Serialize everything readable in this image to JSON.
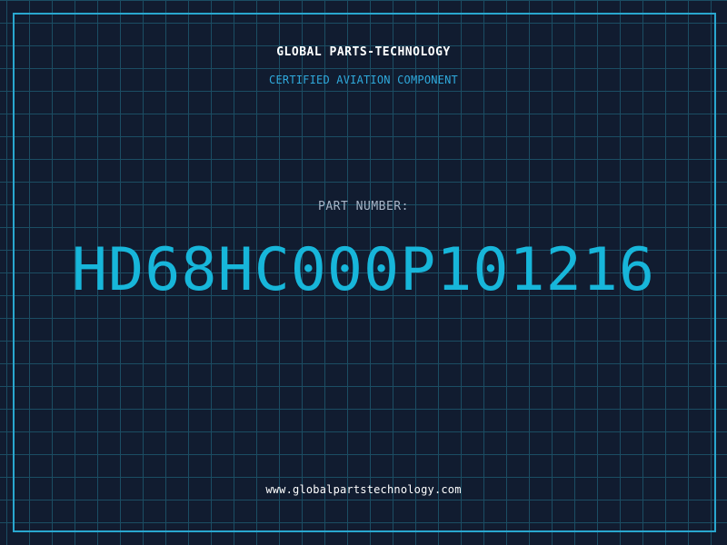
{
  "header": {
    "company": "GLOBAL PARTS-TECHNOLOGY",
    "subtitle": "CERTIFIED AVIATION COMPONENT"
  },
  "part": {
    "label": "PART NUMBER:",
    "number": "HD68HC000P101216"
  },
  "footer": {
    "url": "www.globalpartstechnology.com"
  },
  "colors": {
    "background": "#111c30",
    "grid": "#1b4d63",
    "border": "#29a7cf",
    "accent": "#17b6da"
  }
}
